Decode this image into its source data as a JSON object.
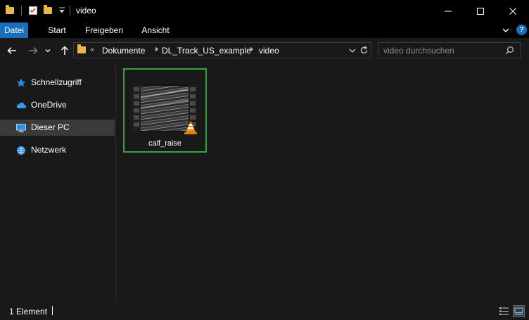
{
  "window": {
    "title": "video",
    "controls": {
      "minimize": "—",
      "maximize": "☐",
      "close": "✕"
    }
  },
  "ribbon": {
    "tabs": [
      "Datei",
      "Start",
      "Freigeben",
      "Ansicht"
    ],
    "active_tab": "Datei",
    "accent": "#1a6dbf"
  },
  "address": {
    "overflow": "«",
    "breadcrumbs": [
      "Dokumente",
      "DL_Track_US_example",
      "video"
    ]
  },
  "search": {
    "placeholder": "video durchsuchen"
  },
  "nav": {
    "items": [
      {
        "label": "Schnellzugriff",
        "icon": "star-icon"
      },
      {
        "label": "OneDrive",
        "icon": "cloud-icon"
      },
      {
        "label": "Dieser PC",
        "icon": "computer-icon"
      },
      {
        "label": "Netzwerk",
        "icon": "network-icon"
      }
    ],
    "selected": "Dieser PC"
  },
  "files": [
    {
      "name": "calf_raise",
      "icon": "vlc-cone-icon",
      "selected": true
    }
  ],
  "status": {
    "count": "1 Element"
  },
  "colors": {
    "selection_border": "#35a244",
    "folder": "#e6b94a",
    "vlc_orange": "#f08a00"
  }
}
